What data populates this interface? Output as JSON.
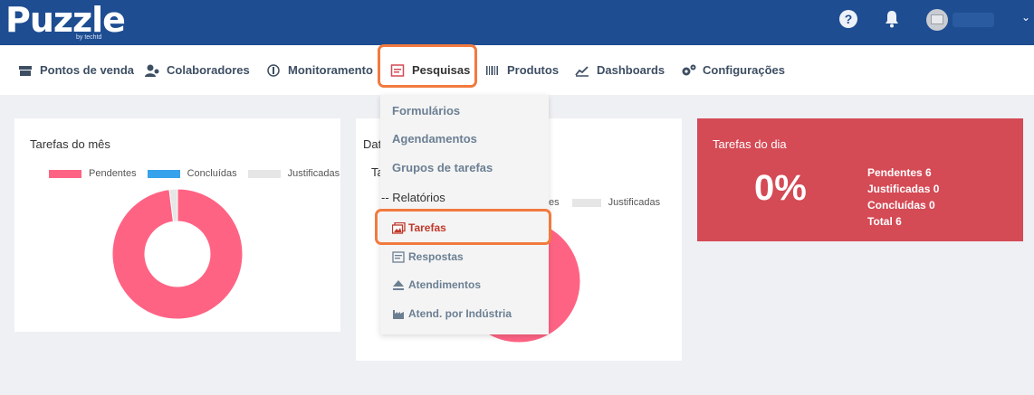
{
  "brand": {
    "name": "Puzzle",
    "sub": "by techtd"
  },
  "header": {
    "help_label": "?"
  },
  "nav": {
    "items": [
      {
        "label": "Pontos de venda"
      },
      {
        "label": "Colaboradores"
      },
      {
        "label": "Monitoramento"
      },
      {
        "label": "Pesquisas"
      },
      {
        "label": "Produtos"
      },
      {
        "label": "Dashboards"
      },
      {
        "label": "Configurações"
      }
    ]
  },
  "card_month": {
    "title": "Tarefas do mês",
    "legend": [
      "Pendentes",
      "Concluídas",
      "Justificadas"
    ]
  },
  "card_middle": {
    "title_partial": "Dat",
    "sub_partial": "Ta",
    "legend_partial": [
      "es",
      "Justificadas"
    ]
  },
  "card_day": {
    "title": "Tarefas do dia",
    "percent": "0%",
    "pendentes": "Pendentes 6",
    "justificadas": "Justificadas 0",
    "concluidas": "Concluídas 0",
    "total": "Total 6"
  },
  "dropdown": {
    "items": [
      "Formulários",
      "Agendamentos",
      "Grupos de tarefas"
    ],
    "section": "-- Relatórios",
    "sub": [
      "Tarefas",
      "Respostas",
      "Atendimentos",
      "Atend. por Indústria"
    ]
  },
  "colors": {
    "header": "#1e4d92",
    "pendentes": "#ff6384",
    "concluidas": "#36a2eb",
    "justificadas": "#e6e6e6",
    "day_card": "#d44a55",
    "highlight": "#f27a3e",
    "active_sub": "#c0392b"
  },
  "chart_data": [
    {
      "type": "pie",
      "title": "Tarefas do mês",
      "categories": [
        "Pendentes",
        "Concluídas",
        "Justificadas"
      ],
      "values": [
        98,
        0,
        2
      ],
      "donut": true,
      "legend": "top"
    },
    {
      "type": "pie",
      "categories": [
        "Pendentes",
        "Justificadas"
      ],
      "values": [
        100,
        0
      ],
      "legend": "top"
    }
  ]
}
